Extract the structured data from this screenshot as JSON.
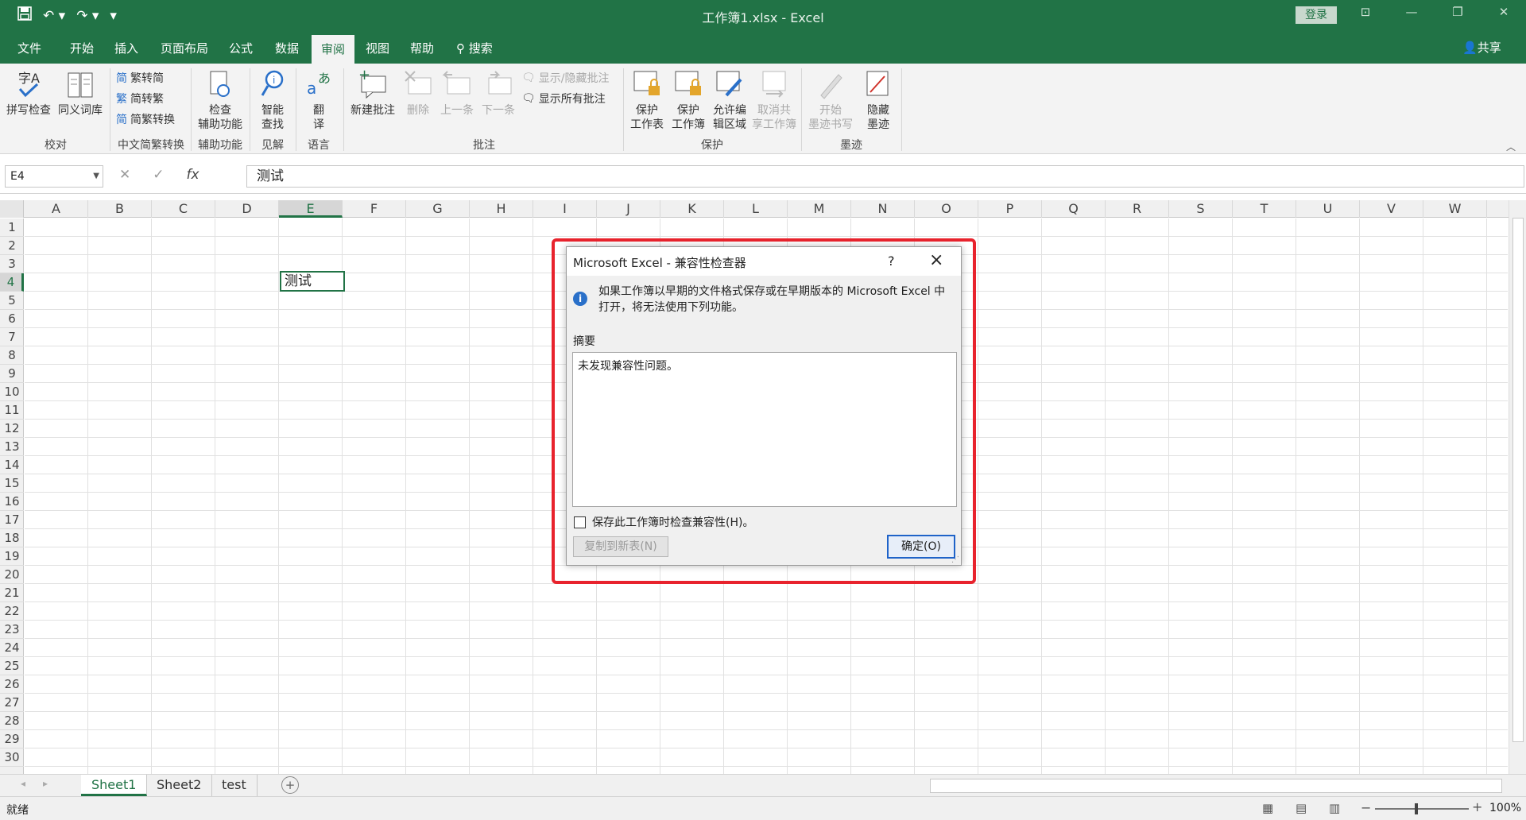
{
  "titlebar": {
    "title": "工作簿1.xlsx - Excel",
    "login": "登录",
    "qat": [
      "save-icon",
      "undo-icon",
      "redo-icon",
      "customize-icon"
    ]
  },
  "tabs": [
    "文件",
    "开始",
    "插入",
    "页面布局",
    "公式",
    "数据",
    "审阅",
    "视图",
    "帮助",
    "搜索"
  ],
  "active_tab": "审阅",
  "share": "共享",
  "ribbon": {
    "proofing": {
      "spell": "拼写检查",
      "thesaurus": "同义词库",
      "group": "校对"
    },
    "chinese": {
      "t2s": "繁转简",
      "s2t": "简转繁",
      "convert": "简繁转换",
      "group": "中文简繁转换"
    },
    "accessibility": {
      "check_l1": "检查",
      "check_l2": "辅助功能",
      "group": "辅助功能"
    },
    "insights": {
      "smart_l1": "智能",
      "smart_l2": "查找",
      "group": "见解"
    },
    "language": {
      "translate_l1": "翻",
      "translate_l2": "译",
      "group": "语言"
    },
    "comments": {
      "new": "新建批注",
      "delete": "删除",
      "prev": "上一条",
      "next": "下一条",
      "show_hide": "显示/隐藏批注",
      "show_all": "显示所有批注",
      "group": "批注"
    },
    "protect": {
      "sheet_l1": "保护",
      "sheet_l2": "工作表",
      "book_l1": "保护",
      "book_l2": "工作簿",
      "range_l1": "允许编",
      "range_l2": "辑区域",
      "unshare_l1": "取消共",
      "unshare_l2": "享工作簿",
      "group": "保护"
    },
    "ink": {
      "start_l1": "开始",
      "start_l2": "墨迹书写",
      "hide_l1": "隐藏",
      "hide_l2": "墨迹",
      "group": "墨迹"
    }
  },
  "formula_bar": {
    "name_box": "E4",
    "fx": "fx",
    "value": "测试"
  },
  "grid": {
    "columns": [
      "A",
      "B",
      "C",
      "D",
      "E",
      "F",
      "G",
      "H",
      "I",
      "J",
      "K",
      "L",
      "M",
      "N",
      "O",
      "P",
      "Q",
      "R",
      "S",
      "T",
      "U",
      "V",
      "W"
    ],
    "rows": [
      "1",
      "2",
      "3",
      "4",
      "5",
      "6",
      "7",
      "8",
      "9",
      "10",
      "11",
      "12",
      "13",
      "14",
      "15",
      "16",
      "17",
      "18",
      "19",
      "20",
      "21",
      "22",
      "23",
      "24",
      "25",
      "26",
      "27",
      "28",
      "29",
      "30"
    ],
    "active_cell_text": "测试"
  },
  "sheets": [
    "Sheet1",
    "Sheet2",
    "test"
  ],
  "status": {
    "ready": "就绪",
    "zoom": "100%"
  },
  "dialog": {
    "title": "Microsoft Excel - 兼容性检查器",
    "help": "?",
    "info": "如果工作簿以早期的文件格式保存或在早期版本的 Microsoft Excel 中打开，将无法使用下列功能。",
    "summary_label": "摘要",
    "summary_text": "未发现兼容性问题。",
    "check_label": "保存此工作簿时检查兼容性(H)。",
    "copy_btn": "复制到新表(N)",
    "ok_btn": "确定(O)"
  },
  "colors": {
    "excel_green": "#217346",
    "highlight_red": "#e8232d"
  }
}
